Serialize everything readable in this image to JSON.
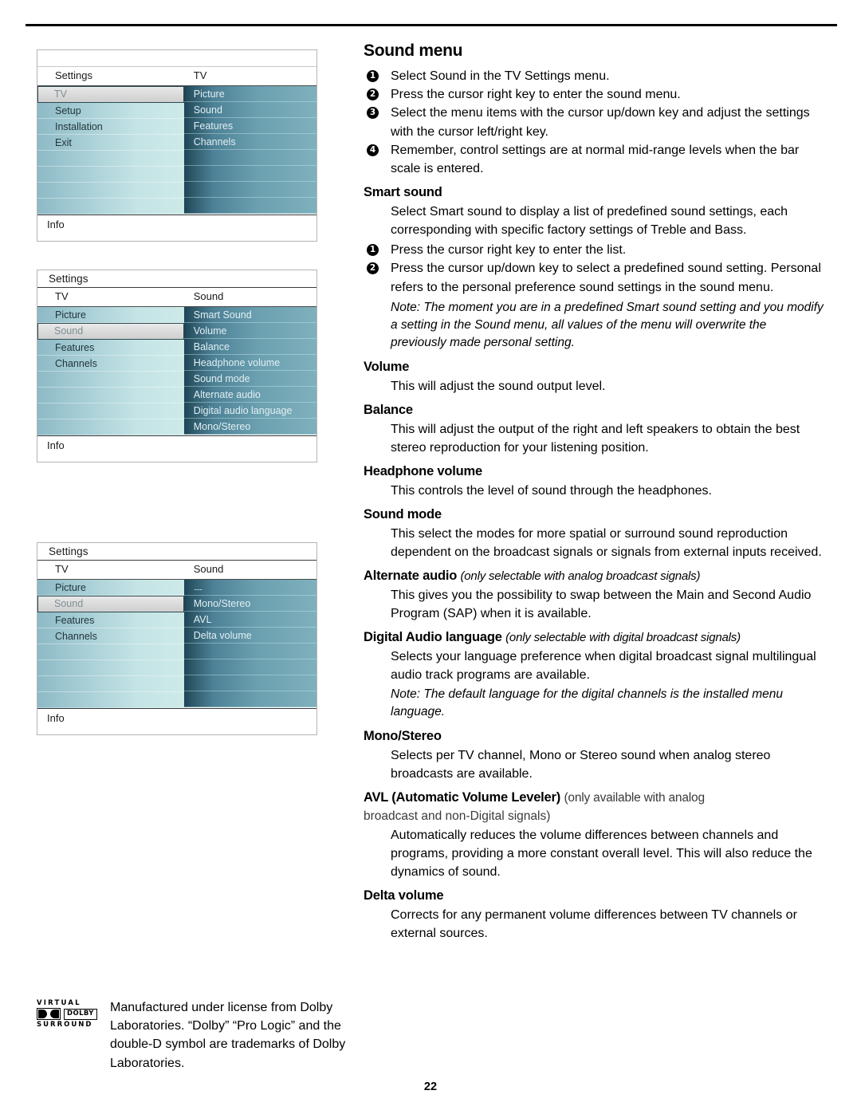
{
  "page": {
    "number": "22"
  },
  "osd_menus": [
    {
      "name": "tv-settings-menu",
      "has_blank_bar": true,
      "title": "",
      "left_header": "Settings",
      "right_header": "TV",
      "left_items": [
        {
          "label": "TV",
          "selected": true
        },
        {
          "label": "Setup",
          "selected": false
        },
        {
          "label": "Installation",
          "selected": false
        },
        {
          "label": "Exit",
          "selected": false
        },
        {
          "label": "",
          "selected": false
        },
        {
          "label": "",
          "selected": false
        },
        {
          "label": "",
          "selected": false
        },
        {
          "label": "",
          "selected": false
        }
      ],
      "right_items": [
        {
          "label": "Picture"
        },
        {
          "label": "Sound"
        },
        {
          "label": "Features"
        },
        {
          "label": "Channels"
        },
        {
          "label": ""
        },
        {
          "label": ""
        },
        {
          "label": ""
        },
        {
          "label": ""
        }
      ],
      "info_label": "Info"
    },
    {
      "name": "sound-menu",
      "has_blank_bar": false,
      "title": "Settings",
      "left_header": "TV",
      "right_header": "Sound",
      "left_items": [
        {
          "label": "Picture",
          "selected": false
        },
        {
          "label": "Sound",
          "selected": true
        },
        {
          "label": "Features",
          "selected": false
        },
        {
          "label": "Channels",
          "selected": false
        },
        {
          "label": "",
          "selected": false
        },
        {
          "label": "",
          "selected": false
        },
        {
          "label": "",
          "selected": false
        },
        {
          "label": "",
          "selected": false
        }
      ],
      "right_items": [
        {
          "label": "Smart Sound"
        },
        {
          "label": "Volume"
        },
        {
          "label": "Balance"
        },
        {
          "label": "Headphone volume"
        },
        {
          "label": "Sound mode"
        },
        {
          "label": "Alternate audio"
        },
        {
          "label": "Digital audio language"
        },
        {
          "label": "Mono/Stereo"
        }
      ],
      "info_label": "Info"
    },
    {
      "name": "sound-menu-scrolled",
      "has_blank_bar": false,
      "title": "Settings",
      "left_header": "TV",
      "right_header": "Sound",
      "left_items": [
        {
          "label": "Picture",
          "selected": false
        },
        {
          "label": "Sound",
          "selected": true
        },
        {
          "label": "Features",
          "selected": false
        },
        {
          "label": "Channels",
          "selected": false
        },
        {
          "label": "",
          "selected": false
        },
        {
          "label": "",
          "selected": false
        },
        {
          "label": "",
          "selected": false
        },
        {
          "label": "",
          "selected": false
        }
      ],
      "right_items": [
        {
          "label": ".......",
          "dots": true
        },
        {
          "label": "Mono/Stereo"
        },
        {
          "label": "AVL"
        },
        {
          "label": "Delta volume"
        },
        {
          "label": ""
        },
        {
          "label": ""
        },
        {
          "label": ""
        },
        {
          "label": ""
        }
      ],
      "info_label": "Info"
    }
  ],
  "content": {
    "title": "Sound menu",
    "intro_steps": [
      "Select Sound in the TV Settings menu.",
      "Press the cursor right key to enter the sound menu.",
      "Select the menu items with the cursor up/down key and adjust the settings with the cursor left/right key.",
      "Remember, control settings are at normal mid-range levels when the bar scale is entered."
    ],
    "sections": {
      "smart_sound": {
        "heading": "Smart sound",
        "intro": "Select Smart sound to display a list of predefined sound settings, each corresponding with specific factory settings of Treble and Bass.",
        "steps": [
          "Press the cursor right key to enter the list.",
          "Press the cursor up/down key to select a predefined sound setting. Personal refers to the personal preference sound settings in the sound menu."
        ],
        "note": "Note: The moment you are in a predefined Smart sound setting and you modify a setting in the Sound menu, all values of the menu will overwrite the previously made personal setting."
      },
      "volume": {
        "heading": "Volume",
        "body": "This will adjust the sound output level."
      },
      "balance": {
        "heading": "Balance",
        "body": "This will adjust the output of the right and left speakers to obtain the best stereo reproduction for your listening position."
      },
      "headphone_volume": {
        "heading": "Headphone volume",
        "body": "This controls the level of sound through the headphones."
      },
      "sound_mode": {
        "heading": "Sound mode",
        "body": "This select the modes for more spatial or surround sound reproduction dependent on the broadcast signals or signals from external inputs received."
      },
      "alternate_audio": {
        "heading": "Alternate audio",
        "qualifier": "(only selectable with analog broadcast signals)",
        "body": "This gives you the possibility to swap between the Main and Second Audio Program (SAP) when it is available."
      },
      "digital_audio_language": {
        "heading": "Digital Audio language",
        "qualifier": "(only selectable with digital broadcast signals)",
        "body": "Selects your language preference when digital broadcast signal multilingual audio track programs are available.",
        "note": "Note: The default language for the digital channels is the installed menu language."
      },
      "mono_stereo": {
        "heading": "Mono/Stereo",
        "body": "Selects per TV channel, Mono or Stereo sound when analog stereo broadcasts are available."
      },
      "avl": {
        "heading": "AVL (Automatic Volume Leveler)",
        "qualifier": "(only available with analog",
        "qualifier_cont": "broadcast and non-Digital signals)",
        "body": "Automatically reduces the volume differences between channels and programs, providing a more constant overall level. This will also reduce the dynamics of sound."
      },
      "delta_volume": {
        "heading": "Delta volume",
        "body": "Corrects for any permanent volume differences between TV channels or external sources."
      }
    }
  },
  "dolby": {
    "virtual": "VIRTUAL",
    "brand": "DOLBY",
    "surround": "SURROUND",
    "text": "Manufactured under license from Dolby Laboratories. “Dolby” “Pro Logic” and the double-D symbol are trademarks of Dolby Laboratories."
  }
}
